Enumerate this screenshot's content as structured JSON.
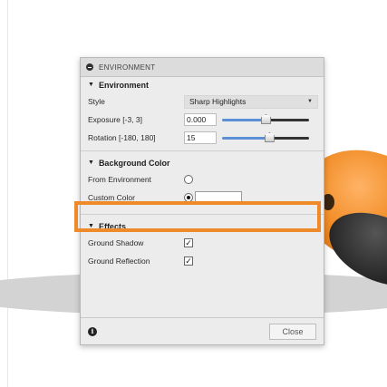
{
  "dialog": {
    "title": "ENVIRONMENT",
    "environment_section": {
      "header": "Environment",
      "style": {
        "label": "Style",
        "value": "Sharp Highlights"
      },
      "exposure": {
        "label": "Exposure [-3, 3]",
        "value": "0.000",
        "slider_fraction": 0.5
      },
      "rotation": {
        "label": "Rotation [-180, 180]",
        "value": "15",
        "slider_fraction": 0.54
      }
    },
    "background_section": {
      "header": "Background Color",
      "from_environment": {
        "label": "From Environment",
        "selected": false
      },
      "custom_color": {
        "label": "Custom Color",
        "selected": true,
        "color": "#ffffff"
      }
    },
    "effects_section": {
      "header": "Effects",
      "ground_shadow": {
        "label": "Ground Shadow",
        "checked": true
      },
      "ground_reflection": {
        "label": "Ground Reflection",
        "checked": true
      }
    },
    "footer": {
      "info_icon_glyph": "i",
      "close_label": "Close"
    }
  },
  "colors": {
    "highlight": "#ef8a2a",
    "slider_fill": "#5b8fd6",
    "product_orange": "#f08a22"
  }
}
